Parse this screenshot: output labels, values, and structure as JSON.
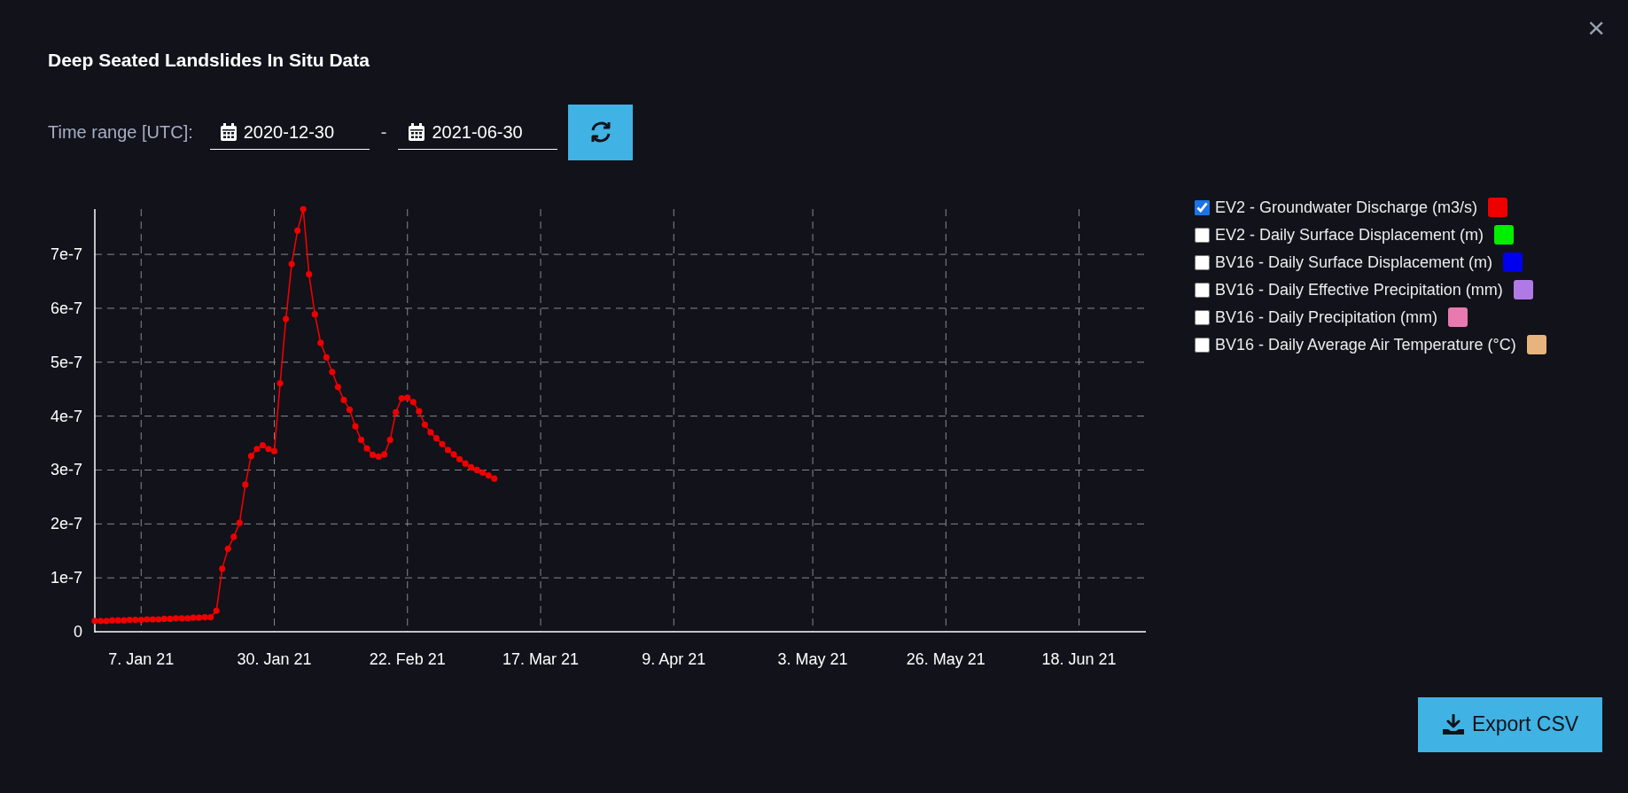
{
  "dialog": {
    "title": "Deep Seated Landslides In Situ Data",
    "close": "×"
  },
  "time_range": {
    "label": "Time range [UTC]:",
    "start": "2020-12-30",
    "separator": "-",
    "end": "2021-06-30"
  },
  "chart": {
    "chart_data": {
      "type": "line",
      "x": [
        "2020-12-30",
        "2020-12-31",
        "2021-01-01",
        "2021-01-02",
        "2021-01-03",
        "2021-01-04",
        "2021-01-05",
        "2021-01-06",
        "2021-01-07",
        "2021-01-08",
        "2021-01-09",
        "2021-01-10",
        "2021-01-11",
        "2021-01-12",
        "2021-01-13",
        "2021-01-14",
        "2021-01-15",
        "2021-01-16",
        "2021-01-17",
        "2021-01-18",
        "2021-01-19",
        "2021-01-20",
        "2021-01-21",
        "2021-01-22",
        "2021-01-23",
        "2021-01-24",
        "2021-01-25",
        "2021-01-26",
        "2021-01-27",
        "2021-01-28",
        "2021-01-29",
        "2021-01-30",
        "2021-01-31",
        "2021-02-01",
        "2021-02-02",
        "2021-02-03",
        "2021-02-04",
        "2021-02-05",
        "2021-02-06",
        "2021-02-07",
        "2021-02-08",
        "2021-02-09",
        "2021-02-10",
        "2021-02-11",
        "2021-02-12",
        "2021-02-13",
        "2021-02-14",
        "2021-02-15",
        "2021-02-16",
        "2021-02-17",
        "2021-02-18",
        "2021-02-19",
        "2021-02-20",
        "2021-02-21",
        "2021-02-22",
        "2021-02-23",
        "2021-02-24",
        "2021-02-25",
        "2021-02-26",
        "2021-02-27",
        "2021-02-28",
        "2021-03-01",
        "2021-03-02",
        "2021-03-03",
        "2021-03-04",
        "2021-03-05",
        "2021-03-06",
        "2021-03-07",
        "2021-03-08",
        "2021-03-09"
      ],
      "grid": true,
      "series": [
        {
          "color": "#ee0000",
          "marker": true,
          "values": [
            2e-08,
            2e-08,
            2e-08,
            2.1e-08,
            2.1e-08,
            2.1e-08,
            2.2e-08,
            2.2e-08,
            2.2e-08,
            2.3e-08,
            2.3e-08,
            2.3e-08,
            2.4e-08,
            2.4e-08,
            2.5e-08,
            2.5e-08,
            2.5e-08,
            2.6e-08,
            2.6e-08,
            2.7e-08,
            2.7e-08,
            3.9e-08,
            1.17e-07,
            1.54e-07,
            1.76e-07,
            2.02e-07,
            2.73e-07,
            3.26e-07,
            3.39e-07,
            3.46e-07,
            3.39e-07,
            3.35e-07,
            4.61e-07,
            5.8e-07,
            6.82e-07,
            7.44e-07,
            7.84e-07,
            6.63e-07,
            5.89e-07,
            5.36e-07,
            5.09e-07,
            4.82e-07,
            4.54e-07,
            4.3e-07,
            4.12e-07,
            3.81e-07,
            3.56e-07,
            3.4e-07,
            3.28e-07,
            3.25e-07,
            3.29e-07,
            3.56e-07,
            4.07e-07,
            4.33e-07,
            4.34e-07,
            4.26e-07,
            4.09e-07,
            3.84e-07,
            3.7e-07,
            3.59e-07,
            3.48e-07,
            3.37e-07,
            3.29e-07,
            3.2e-07,
            3.12e-07,
            3.05e-07,
            3e-07,
            2.95e-07,
            2.9e-07,
            2.84e-07
          ]
        }
      ],
      "xlim": [
        "2020-12-30",
        "2021-06-30"
      ],
      "ylim": [
        0,
        7.84e-07
      ],
      "xticks": [
        {
          "value": "2021-01-07",
          "label": "7. Jan 21"
        },
        {
          "value": "2021-01-30",
          "label": "30. Jan 21"
        },
        {
          "value": "2021-02-22",
          "label": "22. Feb 21"
        },
        {
          "value": "2021-03-17",
          "label": "17. Mar 21"
        },
        {
          "value": "2021-04-09",
          "label": "9. Apr 21"
        },
        {
          "value": "2021-05-03",
          "label": "3. May 21"
        },
        {
          "value": "2021-05-26",
          "label": "26. May 21"
        },
        {
          "value": "2021-06-18",
          "label": "18. Jun 21"
        }
      ],
      "yticks": [
        {
          "value": 0,
          "label": "0"
        },
        {
          "value": 1e-07,
          "label": "1e-7"
        },
        {
          "value": 2e-07,
          "label": "2e-7"
        },
        {
          "value": 3e-07,
          "label": "3e-7"
        },
        {
          "value": 4e-07,
          "label": "4e-7"
        },
        {
          "value": 5e-07,
          "label": "5e-7"
        },
        {
          "value": 6e-07,
          "label": "6e-7"
        },
        {
          "value": 7e-07,
          "label": "7e-7"
        }
      ]
    }
  },
  "legend": [
    {
      "label": "EV2 - Groundwater Discharge (m3/s)",
      "checked": true,
      "color": "#ee0000"
    },
    {
      "label": "EV2 - Daily Surface Displacement (m)",
      "checked": false,
      "color": "#00ee00"
    },
    {
      "label": "BV16 - Daily Surface Displacement (m)",
      "checked": false,
      "color": "#0000ee"
    },
    {
      "label": "BV16 - Daily Effective Precipitation (mm)",
      "checked": false,
      "color": "#b07ae6"
    },
    {
      "label": "BV16 - Daily Precipitation (mm)",
      "checked": false,
      "color": "#e87ab0"
    },
    {
      "label": "BV16 - Daily Average Air Temperature (°C)",
      "checked": false,
      "color": "#e8b47e"
    }
  ],
  "export_button": "Export CSV"
}
